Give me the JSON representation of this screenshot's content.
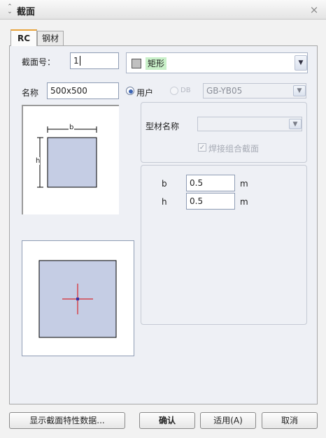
{
  "window": {
    "title": "截面",
    "title_icon": "collapse-icon",
    "close_icon": "close-icon"
  },
  "tabs": [
    {
      "label": "RC",
      "active": true
    },
    {
      "label": "钢材",
      "active": false
    }
  ],
  "section_no": {
    "label": "截面号：",
    "value": "1"
  },
  "shape": {
    "value": "矩形",
    "swatch_color": "#c0c0c0"
  },
  "name": {
    "label": "名称",
    "value": "500x500"
  },
  "source": {
    "user_label": "用户",
    "user_selected": true,
    "db_label": "DB",
    "db_enabled": false,
    "db_value": "GB-YB05"
  },
  "shape_diagram": {
    "b_label": "b",
    "h_label": "h",
    "fill": "#c5cde4"
  },
  "steel": {
    "name_label": "型材名称",
    "name_value": "",
    "welded_label": "焊接组合截面",
    "welded_checked": true
  },
  "dims": [
    {
      "label": "b",
      "value": "0.5",
      "unit": "m"
    },
    {
      "label": "h",
      "value": "0.5",
      "unit": "m"
    }
  ],
  "buttons": {
    "show_props": "显示截面特性数据...",
    "ok": "确认",
    "apply": "适用(A)",
    "cancel": "取消"
  },
  "colors": {
    "accent_tab": "#e8a23a",
    "section_fill": "#c5cde4",
    "centroid_cross": "#dd0000"
  }
}
